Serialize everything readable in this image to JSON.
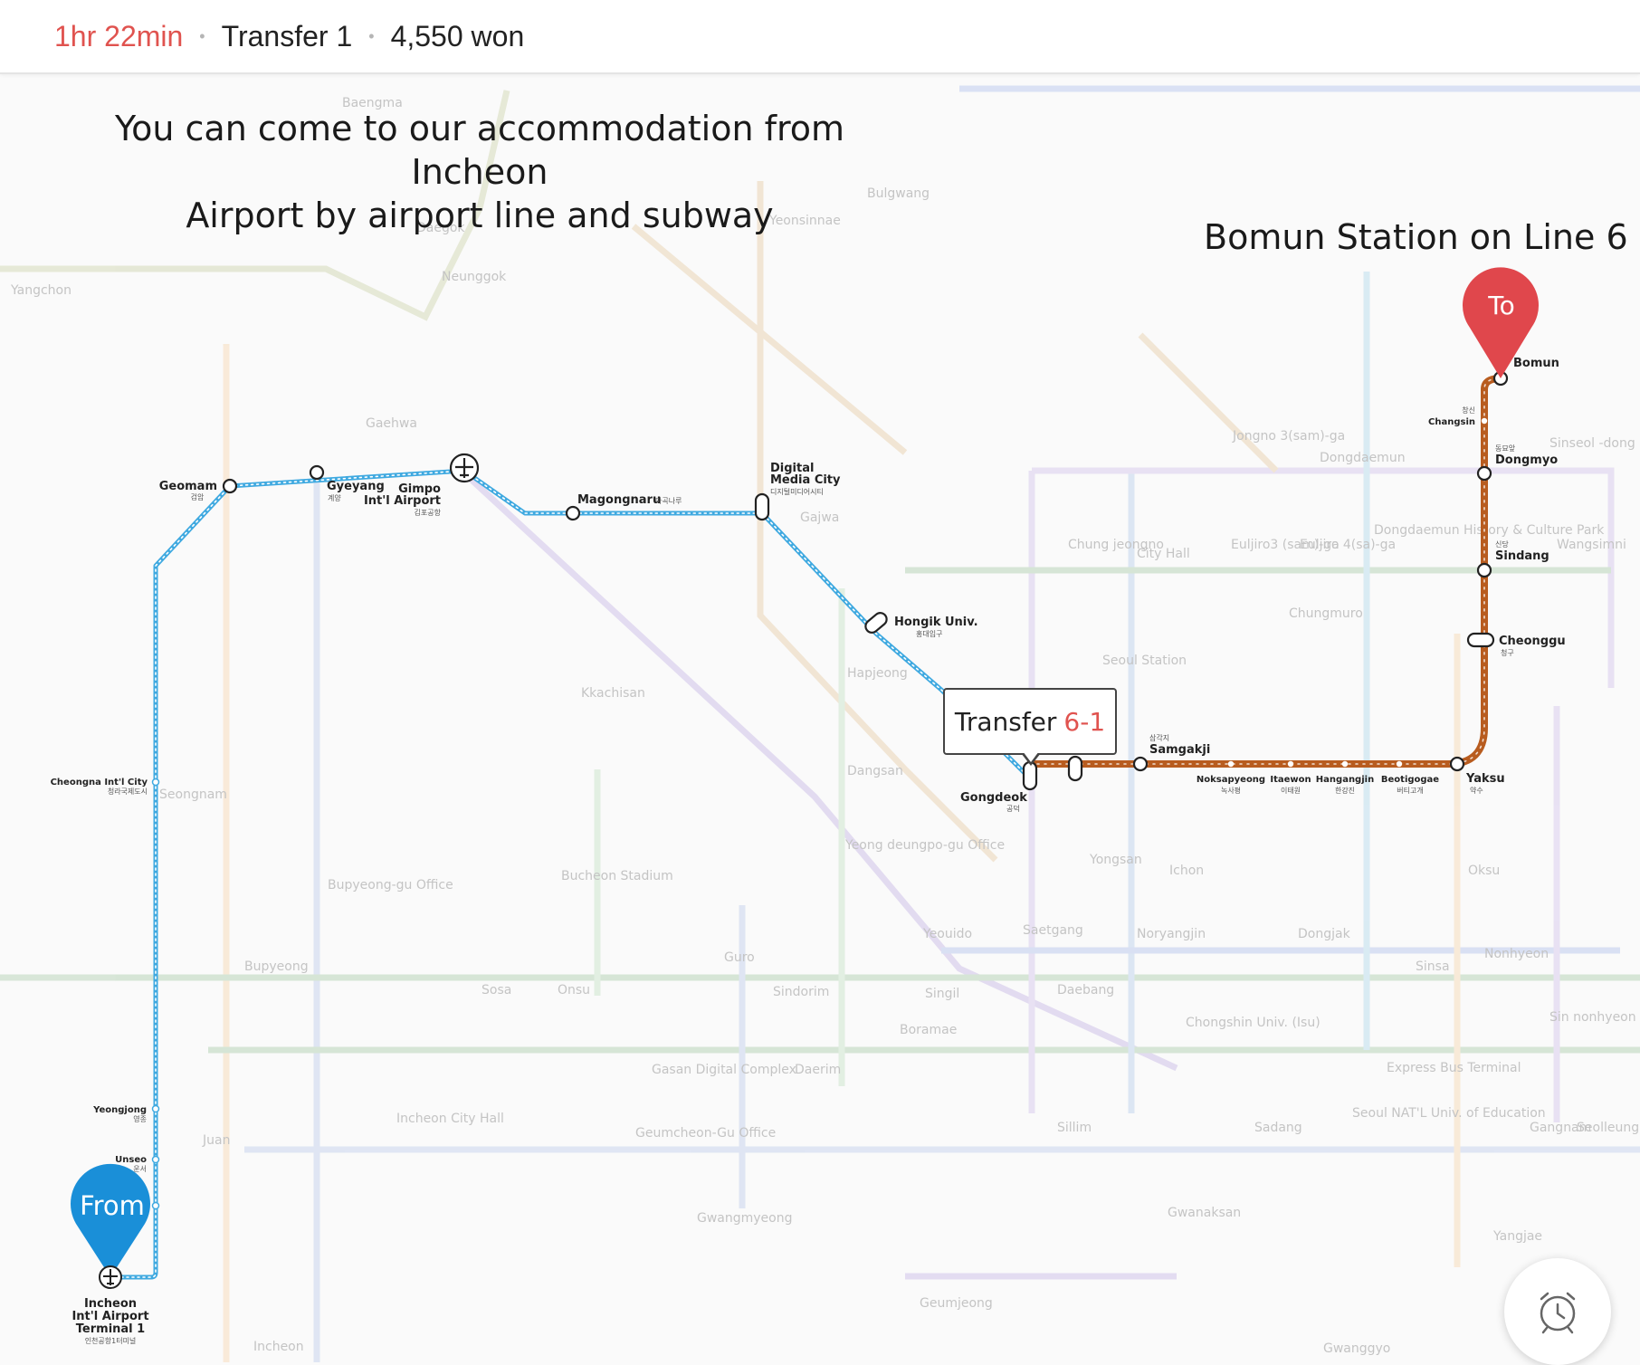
{
  "header": {
    "duration": "1hr 22min",
    "transfers": "Transfer 1",
    "fare": "4,550 won"
  },
  "captions": {
    "intro_line1": "You can come to our accommodation from Incheon",
    "intro_line2": "Airport by airport line and subway",
    "destination": "Bomun Station on Line 6"
  },
  "markers": {
    "from": "From",
    "to": "To"
  },
  "transfer": {
    "label": "Transfer",
    "line": "6-1"
  },
  "route_colors": {
    "airport_line": "#3fa9e0",
    "line6": "#b85c1f",
    "from_marker": "#1a8fd8",
    "to_marker": "#e0474c"
  },
  "stations": {
    "incheon_t1": {
      "name1": "Incheon",
      "name2": "Int'l Airport",
      "name3": "Terminal 1",
      "sub": "인천공항1터미널"
    },
    "unseo": {
      "name": "Unseo",
      "sub": "운서"
    },
    "yeongjong": {
      "name": "Yeongjong",
      "sub": "영종"
    },
    "cheongna": {
      "name": "Cheongna Int'l City",
      "sub": "청라국제도시"
    },
    "geomam": {
      "name": "Geomam",
      "sub": "검암"
    },
    "gyeyang": {
      "name": "Gyeyang",
      "sub": "계양"
    },
    "gimpo": {
      "name1": "Gimpo",
      "name2": "Int'l Airport",
      "sub": "김포공항"
    },
    "magongnaru": {
      "name": "Magongnaru",
      "sub": "마곡나루"
    },
    "dmc": {
      "name1": "Digital",
      "name2": "Media City",
      "sub": "디지털미디어시티"
    },
    "hongik": {
      "name": "Hongik Univ.",
      "sub": "홍대입구"
    },
    "gongdeok": {
      "name": "Gongdeok",
      "sub": "공덕"
    },
    "samgakji": {
      "name": "Samgakji",
      "sub": "삼각지"
    },
    "noksapyeong": {
      "name": "Noksapyeong",
      "sub": "녹사평"
    },
    "itaewon": {
      "name": "Itaewon",
      "sub": "이태원"
    },
    "hangangjin": {
      "name": "Hangangjin",
      "sub": "한강진"
    },
    "beotigogae": {
      "name": "Beotigogae",
      "sub": "버티고개"
    },
    "yaksu": {
      "name": "Yaksu",
      "sub": "약수"
    },
    "cheonggu": {
      "name": "Cheonggu",
      "sub": "청구"
    },
    "sindang": {
      "name": "Sindang",
      "sub": "신당"
    },
    "dongmyo": {
      "name": "Dongmyo",
      "sub": "동묘앞"
    },
    "changsin": {
      "name": "Changsin",
      "sub": "창신"
    },
    "bomun": {
      "name": "Bomun"
    }
  },
  "background_labels": {
    "seoul_station": "Seoul Station",
    "yongsan": "Yongsan",
    "yeouido": "Yeouido",
    "sindorim": "Sindorim",
    "guro": "Guro",
    "bupyeong": "Bupyeong",
    "juan": "Juan",
    "sadang": "Sadang",
    "dongjak": "Dongjak",
    "oksu": "Oksu",
    "noryangjin": "Noryangjin",
    "ichon": "Ichon",
    "sinsa": "Sinsa",
    "chungmuro": "Chungmuro",
    "dongdaemun": "Dongdaemun",
    "hapjeong": "Hapjeong",
    "dangsan": "Dangsan",
    "gajwa": "Gajwa",
    "bulgwang": "Bulgwang",
    "yeonsinnae": "Yeonsinnae",
    "daegok": "Daegok",
    "baengma": "Baengma",
    "gaehwa": "Gaehwa",
    "neunggok": "Neunggok",
    "yangchon": "Yangchon",
    "kkachisan": "Kkachisan",
    "incheon": "Incheon",
    "geumjeong": "Geumjeong",
    "gwangmyeong": "Gwangmyeong",
    "seongnam": "Seongnam",
    "daerim": "Daerim",
    "boramae": "Boramae",
    "daebang": "Daebang",
    "singil": "Singil",
    "sillim": "Sillim",
    "gangnam": "Gangnam",
    "nonhyeon": "Nonhyeon",
    "jongno3ga": "Jongno 3(sam)-ga",
    "cityhall": "City Hall",
    "euljiro3ga": "Euljiro3 (sam)-ga",
    "euljiro4ga": "Euljiro 4(sa)-ga",
    "chungjeongno": "Chung jeongno",
    "ddp": "Dongdaemun History & Culture Park",
    "bucheon": "Bucheon Stadium",
    "gasan": "Gasan Digital Complex",
    "geumcheon": "Geumcheon-Gu Office",
    "incheoncityhall": "Incheon City Hall",
    "bupyeonggu": "Bupyeong-gu Office",
    "saetgang": "Saetgang",
    "wangsimni": "Wangsimni",
    "sinseol": "Sinseol -dong",
    "chongshin": "Chongshin Univ. (Isu)",
    "express": "Express Bus Terminal",
    "sosa": "Sosa",
    "onsu": "Onsu",
    "gwanaksan": "Gwanaksan",
    "yangjae": "Yangjae",
    "seolleung": "Seolleung",
    "sinnonhyeon": "Sin nonhyeon",
    "gwanggyo": "Gwanggyo",
    "ydpo": "Yeong deungpo-gu Office",
    "seoulnue": "Seoul NAT'L Univ. of Education"
  }
}
